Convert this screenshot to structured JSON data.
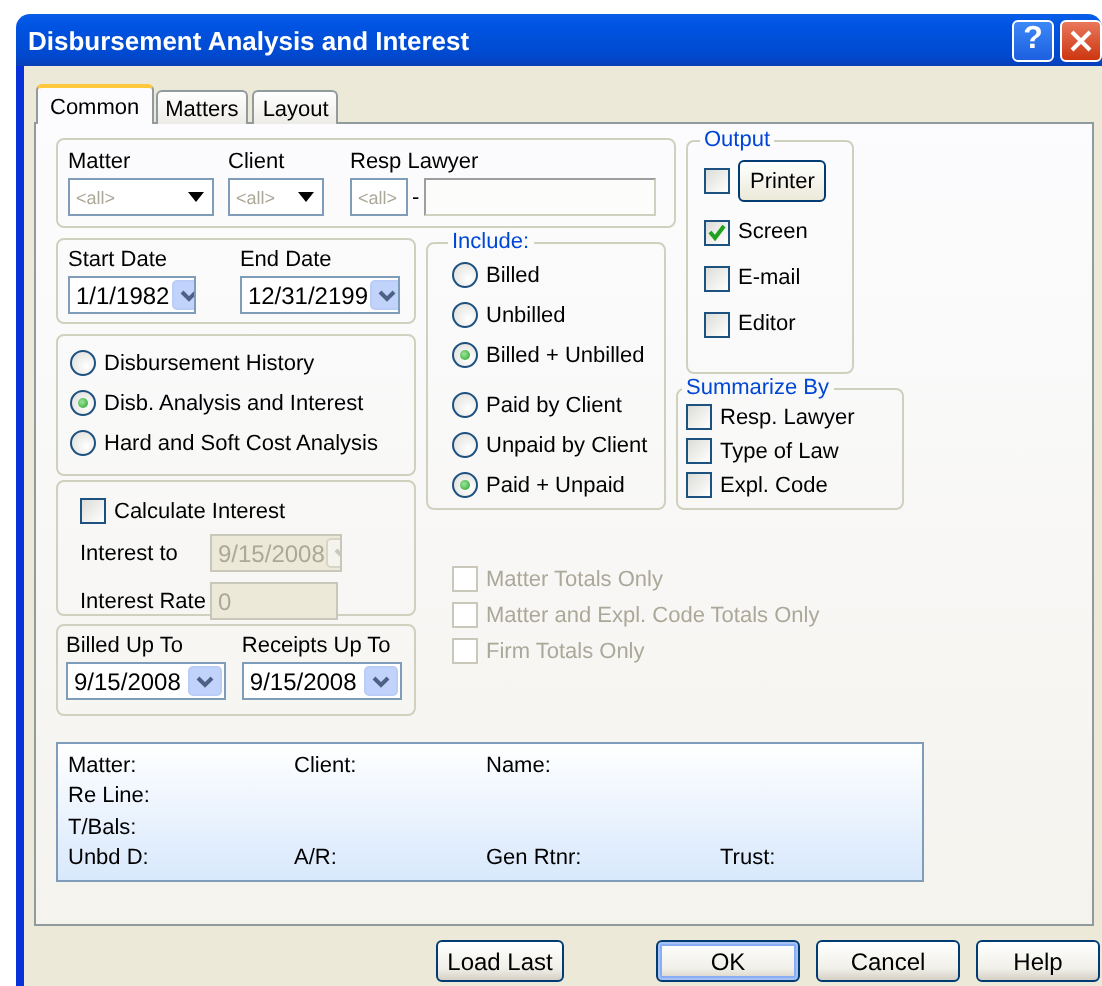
{
  "window": {
    "title": "Disbursement Analysis and Interest",
    "help_label": "?"
  },
  "tabs": [
    {
      "label": "Common",
      "selected": true
    },
    {
      "label": "Matters",
      "selected": false
    },
    {
      "label": "Layout",
      "selected": false
    }
  ],
  "filters": [
    {
      "kind": "combo",
      "label": "Matter",
      "placeholder": "<all>"
    },
    {
      "kind": "combo",
      "label": "Client",
      "placeholder": "<all>"
    },
    {
      "kind": "combo_with_field",
      "label": "Resp Lawyer",
      "placeholder": "<all>",
      "separator": "-"
    }
  ],
  "date_range": [
    {
      "label": "Start Date",
      "value": "1/1/1982"
    },
    {
      "label": "End Date",
      "value": "12/31/2199"
    }
  ],
  "report_types": [
    {
      "label": "Disbursement History",
      "selected": false
    },
    {
      "label": "Disb. Analysis and Interest",
      "selected": true
    },
    {
      "label": "Hard and Soft Cost Analysis",
      "selected": false
    }
  ],
  "interest": {
    "calculate": {
      "label": "Calculate Interest",
      "checked": false
    },
    "fields": [
      {
        "kind": "date",
        "label": "Interest to",
        "value": "9/15/2008",
        "disabled": true
      },
      {
        "kind": "text",
        "label": "Interest Rate",
        "value": "0",
        "disabled": true
      }
    ]
  },
  "cutoff_dates": [
    {
      "label": "Billed Up To",
      "value": "9/15/2008"
    },
    {
      "label": "Receipts Up To",
      "value": "9/15/2008"
    }
  ],
  "include": {
    "title": "Include:",
    "billing": [
      {
        "label": "Billed",
        "selected": false
      },
      {
        "label": "Unbilled",
        "selected": false
      },
      {
        "label": "Billed + Unbilled",
        "selected": true
      }
    ],
    "payment": [
      {
        "label": "Paid by Client",
        "selected": false
      },
      {
        "label": "Unpaid by Client",
        "selected": false
      },
      {
        "label": "Paid + Unpaid",
        "selected": true
      }
    ]
  },
  "output": {
    "title": "Output",
    "options": [
      {
        "kind": "button",
        "label": "Printer",
        "checked": false
      },
      {
        "kind": "label",
        "label": "Screen",
        "checked": true
      },
      {
        "kind": "label",
        "label": "E-mail",
        "checked": false
      },
      {
        "kind": "label",
        "label": "Editor",
        "checked": false
      }
    ]
  },
  "summarize_by": {
    "title": "Summarize By",
    "options": [
      {
        "label": "Resp. Lawyer",
        "checked": false
      },
      {
        "label": "Type of Law",
        "checked": false
      },
      {
        "label": "Expl. Code",
        "checked": false
      }
    ]
  },
  "totals_options": [
    {
      "label": "Matter Totals Only",
      "checked": false,
      "disabled": true
    },
    {
      "label": "Matter and Expl. Code Totals Only",
      "checked": false,
      "disabled": true
    },
    {
      "label": "Firm Totals Only",
      "checked": false,
      "disabled": true
    }
  ],
  "info_panel": {
    "rows": [
      [
        "Matter:",
        "Client:",
        "Name:"
      ],
      [
        "Re Line:"
      ],
      [
        "T/Bals:"
      ],
      [
        "Unbd D:",
        "A/R:",
        "Gen Rtnr:",
        "Trust:"
      ]
    ]
  },
  "buttons": [
    {
      "label": "Load Last",
      "default": false
    },
    {
      "label": "OK",
      "default": true
    },
    {
      "label": "Cancel",
      "default": false
    },
    {
      "label": "Help",
      "default": false
    }
  ]
}
